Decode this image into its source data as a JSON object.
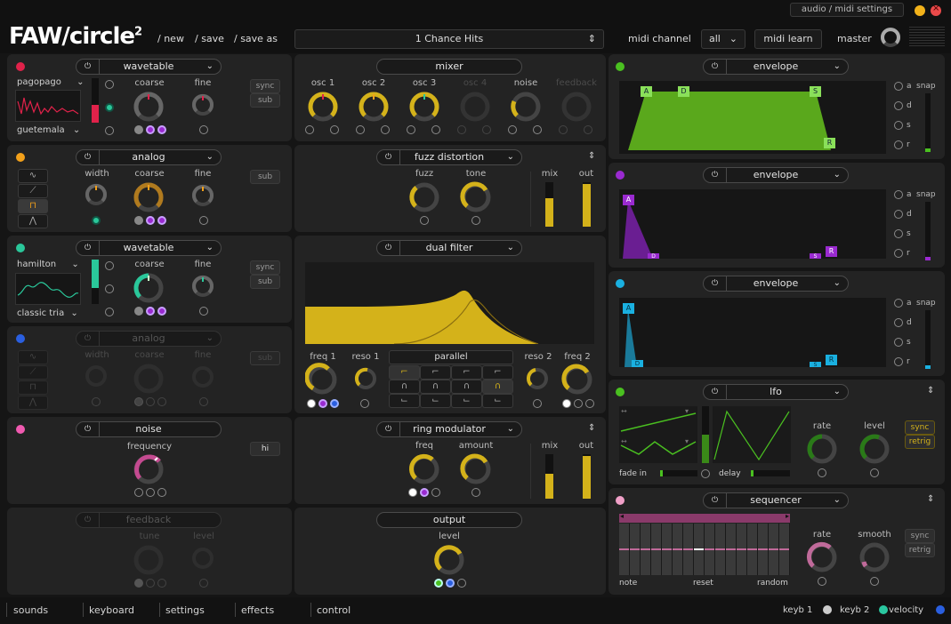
{
  "titlebar": {
    "audio_midi": "audio / midi settings"
  },
  "header": {
    "logo": "FAW/circle",
    "logo_sup": "2",
    "new": "/ new",
    "save": "/ save",
    "save_as": "/ save as",
    "preset": "1 Chance Hits",
    "midi_channel_label": "midi channel",
    "midi_channel_value": "all",
    "midi_learn": "midi learn",
    "master": "master"
  },
  "colors": {
    "accent": "#d4b21a",
    "red": "#e0224a",
    "orange": "#f2a01a",
    "teal": "#2ac79a",
    "blue": "#2a5fe0",
    "pink": "#f05ab0",
    "purple": "#9a2ad0",
    "cyan": "#1ab0e0",
    "green": "#4ac020",
    "env_green": "#5aa81c"
  },
  "osc1": {
    "title": "wavetable",
    "wave_a": "pagopago",
    "wave_b": "guetemala",
    "coarse": "coarse",
    "fine": "fine",
    "sync": "sync",
    "sub": "sub"
  },
  "osc2": {
    "title": "analog",
    "width": "width",
    "coarse": "coarse",
    "fine": "fine",
    "sub": "sub"
  },
  "osc3": {
    "title": "wavetable",
    "wave_a": "hamilton",
    "wave_b": "classic tria",
    "coarse": "coarse",
    "fine": "fine",
    "sync": "sync",
    "sub": "sub"
  },
  "osc4": {
    "title": "analog",
    "width": "width",
    "coarse": "coarse",
    "fine": "fine",
    "sub": "sub"
  },
  "noise": {
    "title": "noise",
    "frequency": "frequency",
    "hi": "hi"
  },
  "feedback": {
    "title": "feedback",
    "tune": "tune",
    "level": "level"
  },
  "mixer": {
    "title": "mixer",
    "labels": [
      "osc 1",
      "osc 2",
      "osc 3",
      "osc 4",
      "noise",
      "feedback"
    ]
  },
  "fuzz": {
    "title": "fuzz distortion",
    "fuzz": "fuzz",
    "tone": "tone",
    "mix": "mix",
    "out": "out"
  },
  "filter": {
    "title": "dual filter",
    "freq1": "freq 1",
    "reso1": "reso 1",
    "mode": "parallel",
    "reso2": "reso 2",
    "freq2": "freq 2"
  },
  "ring": {
    "title": "ring modulator",
    "freq": "freq",
    "amount": "amount",
    "mix": "mix",
    "out": "out"
  },
  "output": {
    "title": "output",
    "level": "level"
  },
  "env1": {
    "title": "envelope",
    "points": [
      "A",
      "D",
      "S",
      "R"
    ],
    "side": [
      "a",
      "d",
      "s",
      "r"
    ],
    "snap": "snap"
  },
  "env2": {
    "title": "envelope",
    "points": [
      "A",
      "D",
      "S",
      "R"
    ],
    "side": [
      "a",
      "d",
      "s",
      "r"
    ],
    "snap": "snap"
  },
  "env3": {
    "title": "envelope",
    "points": [
      "A",
      "D",
      "S",
      "R"
    ],
    "side": [
      "a",
      "d",
      "s",
      "r"
    ],
    "snap": "snap"
  },
  "lfo": {
    "title": "lfo",
    "fade_in": "fade in",
    "delay": "delay",
    "rate": "rate",
    "level": "level",
    "sync": "sync",
    "retrig": "retrig"
  },
  "seq": {
    "title": "sequencer",
    "note": "note",
    "reset": "reset",
    "random": "random",
    "rate": "rate",
    "smooth": "smooth",
    "sync": "sync",
    "retrig": "retrig"
  },
  "footer": {
    "tabs": [
      "sounds",
      "keyboard",
      "settings",
      "effects",
      "control"
    ],
    "keyb1": "keyb 1",
    "keyb2": "keyb 2",
    "velocity": "velocity"
  }
}
